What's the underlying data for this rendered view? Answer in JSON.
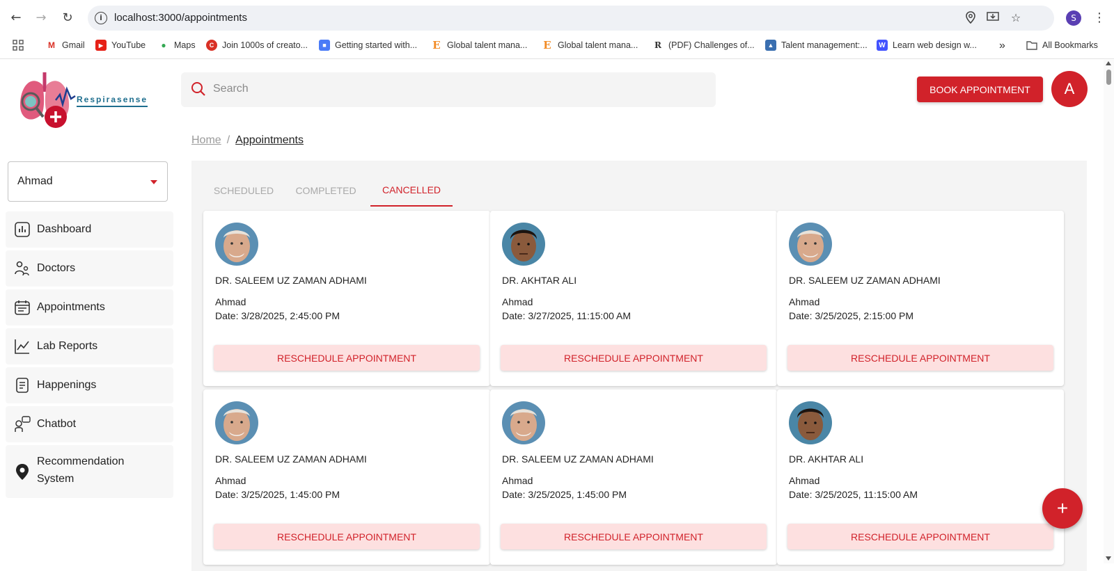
{
  "browser": {
    "url": "localhost:3000/appointments",
    "profile_initial": "S",
    "bookmarks": [
      {
        "label": "Gmail",
        "icon": "gmail-icon"
      },
      {
        "label": "YouTube",
        "icon": "youtube-icon"
      },
      {
        "label": "Maps",
        "icon": "maps-icon"
      },
      {
        "label": "Join 1000s of creato...",
        "icon": "creator-icon"
      },
      {
        "label": "Getting started with...",
        "icon": "drive-icon"
      },
      {
        "label": "Global talent mana...",
        "icon": "e-icon"
      },
      {
        "label": "Global talent mana...",
        "icon": "e-icon"
      },
      {
        "label": "(PDF) Challenges of...",
        "icon": "researchgate-icon"
      },
      {
        "label": "Talent management:...",
        "icon": "talent-icon"
      },
      {
        "label": "Learn web design w...",
        "icon": "webflow-icon"
      }
    ],
    "overflow": "»",
    "all_bookmarks": "All Bookmarks"
  },
  "app": {
    "brand": "Respirasense",
    "search_placeholder": "Search",
    "book_button": "BOOK APPOINTMENT",
    "avatar_initial": "A",
    "accent_color": "#d1222a",
    "user_select": "Ahmad"
  },
  "sidebar": {
    "items": [
      {
        "label": "Dashboard",
        "icon": "dashboard-icon"
      },
      {
        "label": "Doctors",
        "icon": "doctors-icon"
      },
      {
        "label": "Appointments",
        "icon": "calendar-icon"
      },
      {
        "label": "Lab Reports",
        "icon": "chart-icon"
      },
      {
        "label": "Happenings",
        "icon": "document-icon"
      },
      {
        "label": "Chatbot",
        "icon": "chatbot-icon"
      },
      {
        "label": "Recommendation System",
        "line1": "Recommendation",
        "line2": "System",
        "icon": "location-pin-icon"
      }
    ]
  },
  "breadcrumb": {
    "home": "Home",
    "separator": "/",
    "current": "Appointments"
  },
  "tabs": {
    "scheduled": "SCHEDULED",
    "completed": "COMPLETED",
    "cancelled": "CANCELLED",
    "active": "CANCELLED"
  },
  "appointments": [
    {
      "doctor": "DR. SALEEM UZ ZAMAN ADHAMI",
      "patient": "Ahmad",
      "date": "Date: 3/28/2025, 2:45:00 PM",
      "action": "RESCHEDULE APPOINTMENT"
    },
    {
      "doctor": "DR. AKHTAR ALI",
      "patient": "Ahmad",
      "date": "Date: 3/27/2025, 11:15:00 AM",
      "action": "RESCHEDULE APPOINTMENT"
    },
    {
      "doctor": "DR. SALEEM UZ ZAMAN ADHAMI",
      "patient": "Ahmad",
      "date": "Date: 3/25/2025, 2:15:00 PM",
      "action": "RESCHEDULE APPOINTMENT"
    },
    {
      "doctor": "DR. SALEEM UZ ZAMAN ADHAMI",
      "patient": "Ahmad",
      "date": "Date: 3/25/2025, 1:45:00 PM",
      "action": "RESCHEDULE APPOINTMENT"
    },
    {
      "doctor": "DR. SALEEM UZ ZAMAN ADHAMI",
      "patient": "Ahmad",
      "date": "Date: 3/25/2025, 1:45:00 PM",
      "action": "RESCHEDULE APPOINTMENT"
    },
    {
      "doctor": "DR. AKHTAR ALI",
      "patient": "Ahmad",
      "date": "Date: 3/25/2025, 11:15:00 AM",
      "action": "RESCHEDULE APPOINTMENT"
    }
  ],
  "fab": "+"
}
